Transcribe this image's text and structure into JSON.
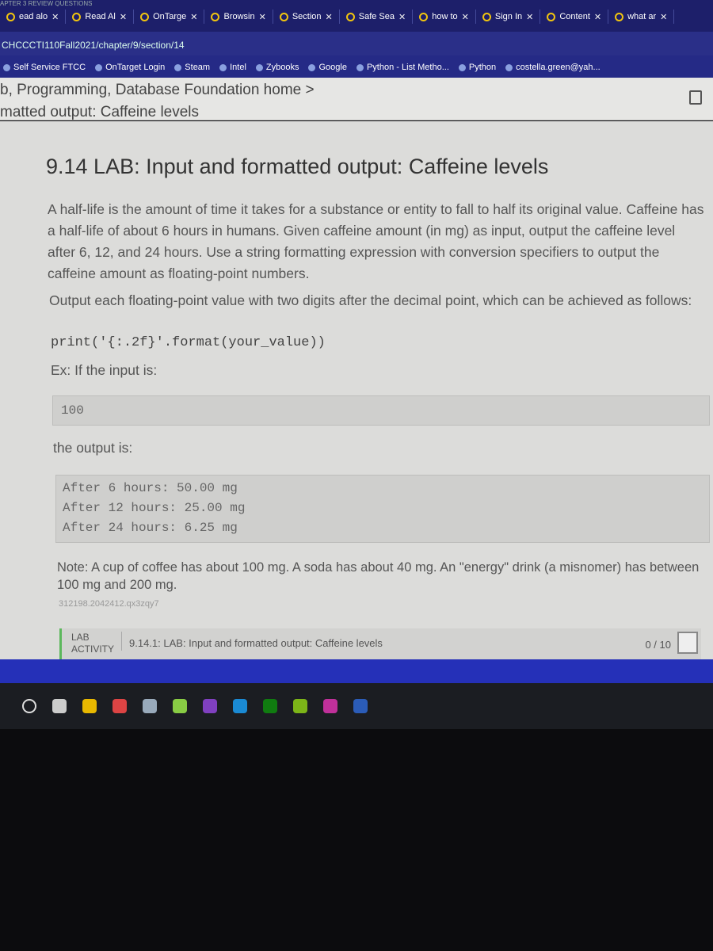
{
  "browser": {
    "top_strip": "APTER 3 REVIEW QUESTIONS",
    "tabs": [
      {
        "label": "ead alo"
      },
      {
        "label": "Read Al"
      },
      {
        "label": "OnTarge"
      },
      {
        "label": "Browsin"
      },
      {
        "label": "Section"
      },
      {
        "label": "Safe Sea"
      },
      {
        "label": "how to"
      },
      {
        "label": "Sign In"
      },
      {
        "label": "Content"
      },
      {
        "label": "what ar"
      }
    ],
    "address": "CHCCCTI110Fall2021/chapter/9/section/14",
    "bookmarks": [
      {
        "label": "Self Service FTCC"
      },
      {
        "label": "OnTarget Login"
      },
      {
        "label": "Steam"
      },
      {
        "label": "Intel"
      },
      {
        "label": "Zybooks"
      },
      {
        "label": "Google"
      },
      {
        "label": "Python - List Metho..."
      },
      {
        "label": "Python"
      },
      {
        "label": "costella.green@yah..."
      }
    ]
  },
  "header": {
    "breadcrumb": "b, Programming, Database Foundation home >",
    "subtitle": "matted output: Caffeine levels"
  },
  "main": {
    "title": "9.14 LAB: Input and formatted output: Caffeine levels",
    "para1": "A half-life is the amount of time it takes for a substance or entity to fall to half its original value. Caffeine has a half-life of about 6 hours in humans. Given caffeine amount (in mg) as input, output the caffeine level after 6, 12, and 24 hours. Use a string formatting expression with conversion specifiers to output the caffeine amount as floating-point numbers.",
    "para2": "Output each floating-point value with two digits after the decimal point, which can be achieved as follows:",
    "code": "print('{:.2f}'.format(your_value))",
    "ex_label": "Ex: If the input is:",
    "input": "100",
    "output_label": "the output is:",
    "output_lines": [
      "After 6 hours: 50.00 mg",
      "After 12 hours: 25.00 mg",
      "After 24 hours: 6.25 mg"
    ],
    "note": "Note: A cup of coffee has about 100 mg. A soda has about 40 mg. An \"energy\" drink (a misnomer) has between 100 mg and 200 mg.",
    "id": "312198.2042412.qx3zqy7",
    "lab": {
      "tag1": "LAB",
      "tag2": "ACTIVITY",
      "title": "9.14.1: LAB: Input and formatted output: Caffeine levels",
      "score": "0 / 10"
    }
  },
  "taskbar": {
    "icons": [
      "search-icon",
      "task-view-icon",
      "file-explorer-icon",
      "chrome-icon",
      "app-icon",
      "notepad-icon",
      "github-icon",
      "edge-icon",
      "xbox-icon",
      "webroot-icon",
      "app-icon",
      "word-icon"
    ]
  }
}
